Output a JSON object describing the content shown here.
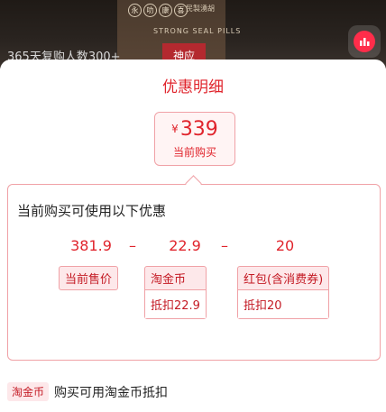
{
  "hero": {
    "brand_chars": [
      "永",
      "叻",
      "康",
      "喜"
    ],
    "brand_sub": "民製湧胡",
    "brand_en": "STRONG SEAL PILLS",
    "seal_text": "神应",
    "buyers_text": "365天复购人数300+"
  },
  "sheet": {
    "title": "优惠明细",
    "current_price": {
      "currency": "¥",
      "amount": "339",
      "label": "当前购买"
    },
    "detail": {
      "heading": "当前购买可使用以下优惠",
      "items": [
        {
          "value": "381.9",
          "tag": "当前售价"
        },
        {
          "operator": "–"
        },
        {
          "value": "22.9",
          "tag": "淘金币",
          "sub": "抵扣22.9"
        },
        {
          "operator": "–"
        },
        {
          "value": "20",
          "tag": "红包(含消费券)",
          "sub": "抵扣20"
        }
      ]
    },
    "footer": {
      "tag": "淘金币",
      "text": "购买可用淘金币抵扣"
    }
  },
  "colors": {
    "accent": "#e0242c",
    "tag_bg": "#fde8ea",
    "border": "#f0a1a6"
  }
}
